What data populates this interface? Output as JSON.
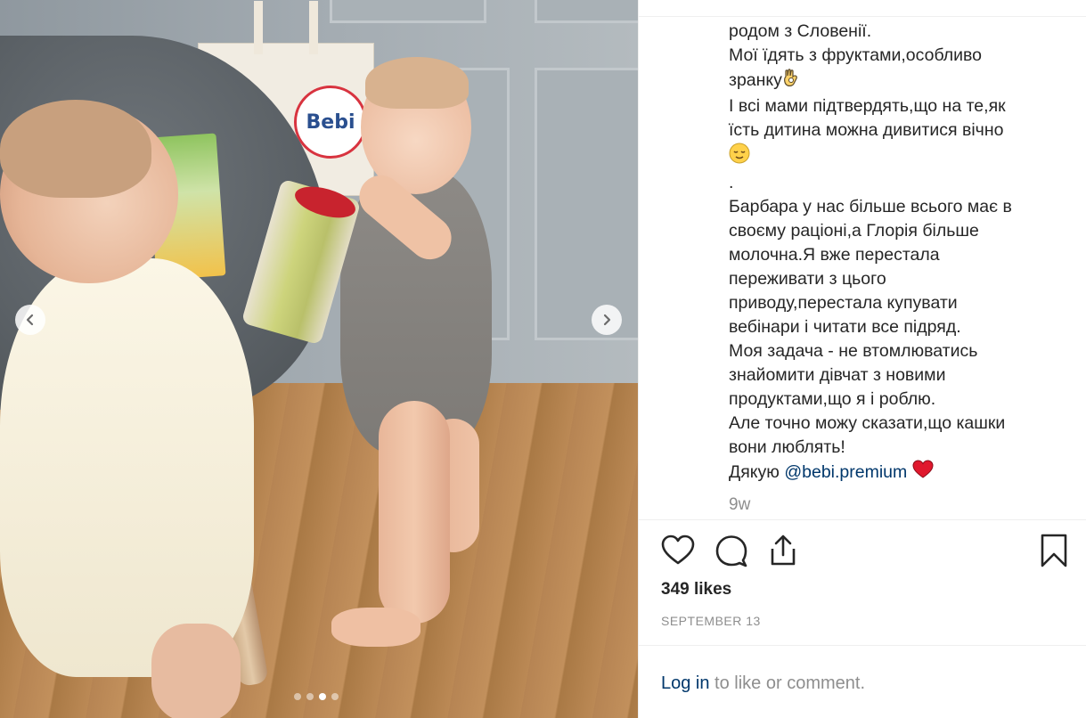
{
  "photo": {
    "bag_logo_text": "Bebi",
    "carousel": {
      "total": 4,
      "active_index": 2
    },
    "prev_icon": "chevron-left-icon",
    "next_icon": "chevron-right-icon"
  },
  "caption": {
    "line1": "родом з Словенії.",
    "line2": "Мої їдять з фруктами,особливо",
    "line3_text": "зранку",
    "line3_emoji": "ok-hand-emoji",
    "line4": "І всі мами підтвердять,що на те,як",
    "line5": "їсть дитина можна дивитися вічно",
    "line6_emoji": "relieved-face-emoji",
    "line7": ".",
    "line8": "Барбара у нас більше всього має в",
    "line9": "своєму раціоні,а Глорія більше",
    "line10": "молочна.Я вже перестала",
    "line11": "переживати з цього",
    "line12": "приводу,перестала купувати",
    "line13": "вебінари і читати все підряд.",
    "line14": "Моя задача - не втомлюватись",
    "line15": "знайомити дівчат з новими",
    "line16": "продуктами,що я і роблю.",
    "line17": "Але точно можу сказати,що кашки",
    "line18": "вони люблять!",
    "thanks_text": "Дякую",
    "mention": "@bebi.premium",
    "thanks_emoji": "red-heart-emoji"
  },
  "time_ago": "9w",
  "actions": {
    "like_icon": "heart-icon",
    "comment_icon": "comment-icon",
    "share_icon": "share-icon",
    "save_icon": "bookmark-icon"
  },
  "likes": "349 likes",
  "date": "SEPTEMBER 13",
  "login": {
    "link": "Log in",
    "rest": " to like or comment."
  }
}
